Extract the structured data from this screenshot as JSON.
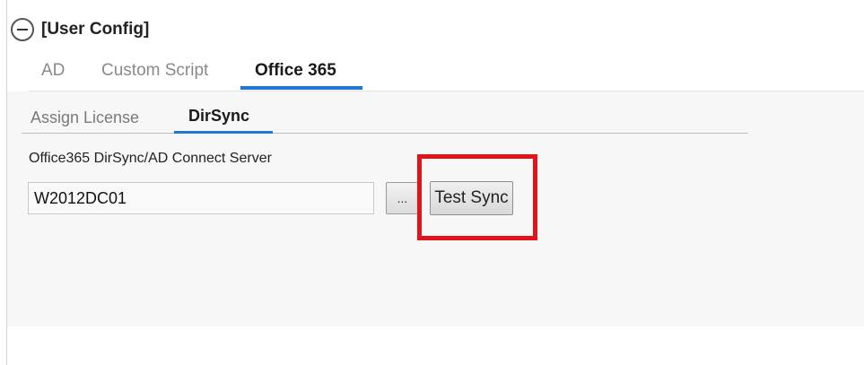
{
  "section": {
    "title": "[User Config]",
    "icon": "collapse-minus-icon"
  },
  "tabs": [
    {
      "label": "AD",
      "active": false
    },
    {
      "label": "Custom Script",
      "active": false
    },
    {
      "label": "Office 365",
      "active": true
    }
  ],
  "subtabs": [
    {
      "label": "Assign License",
      "active": false
    },
    {
      "label": "DirSync",
      "active": true
    }
  ],
  "server_field": {
    "label": "Office365 DirSync/AD Connect Server",
    "value": "W2012DC01"
  },
  "browse_button": {
    "label": "..."
  },
  "test_sync_button": {
    "label": "Test Sync"
  },
  "colors": {
    "accent": "#1e78d4",
    "highlight": "#e2141a",
    "panel_background": "#f7f7f7"
  }
}
